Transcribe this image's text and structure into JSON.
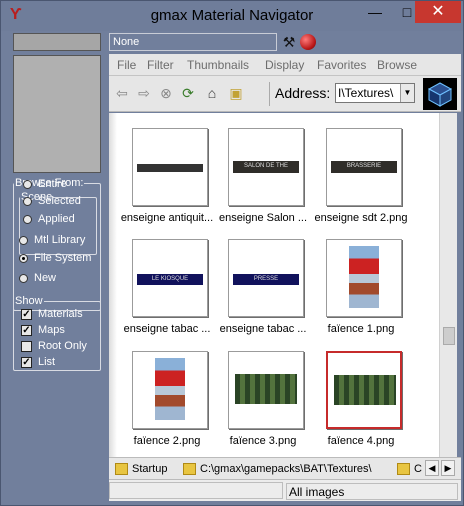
{
  "window": {
    "title": "gmax Material Navigator",
    "minimize_label": "—",
    "maximize_label": "□",
    "close_label": "✕"
  },
  "left_panel": {
    "browse_from_legend": "Browse From:",
    "scene_legend": "Scene",
    "scene_options": [
      {
        "label": "Entire",
        "selected": false
      },
      {
        "label": "Selected",
        "selected": false
      },
      {
        "label": "Applied",
        "selected": false
      }
    ],
    "source_options": [
      {
        "label": "Mtl Library",
        "selected": false
      },
      {
        "label": "File System",
        "selected": true
      },
      {
        "label": "New",
        "selected": false
      }
    ],
    "show_legend": "Show",
    "show_options": [
      {
        "label": "Materials",
        "checked": true
      },
      {
        "label": "Maps",
        "checked": true
      },
      {
        "label": "Root Only",
        "checked": false
      },
      {
        "label": "List",
        "checked": true
      }
    ]
  },
  "material_name": "None",
  "menu": [
    "File",
    "Filter",
    "Thumbnails",
    "Display",
    "Favorites",
    "Browse"
  ],
  "toolbar": {
    "address_label": "Address:",
    "address_value": "I\\Textures\\"
  },
  "files": [
    {
      "label": "enseigne antiquit...",
      "kind": "banner-dark",
      "text": ""
    },
    {
      "label": "enseigne Salon ...",
      "kind": "banner-sign",
      "text": "SALON DE THE"
    },
    {
      "label": "enseigne sdt 2.png",
      "kind": "banner-sign",
      "text": "BRASSERIE"
    },
    {
      "label": "enseigne tabac ...",
      "kind": "banner-blue",
      "text": "LE KIOSQUE"
    },
    {
      "label": "enseigne tabac ...",
      "kind": "banner-blue",
      "text": "PRESSE"
    },
    {
      "label": "faïence 1.png",
      "kind": "tile",
      "text": ""
    },
    {
      "label": "faïence 2.png",
      "kind": "tile",
      "text": ""
    },
    {
      "label": "faïence 3.png",
      "kind": "green",
      "text": ""
    },
    {
      "label": "faïence 4.png",
      "kind": "green",
      "text": "",
      "selected": true
    }
  ],
  "favorites": [
    {
      "label": "Startup"
    },
    {
      "label": "C:\\gmax\\gamepacks\\BAT\\Textures\\"
    },
    {
      "label": "C:"
    }
  ],
  "status": {
    "text": "All images"
  }
}
